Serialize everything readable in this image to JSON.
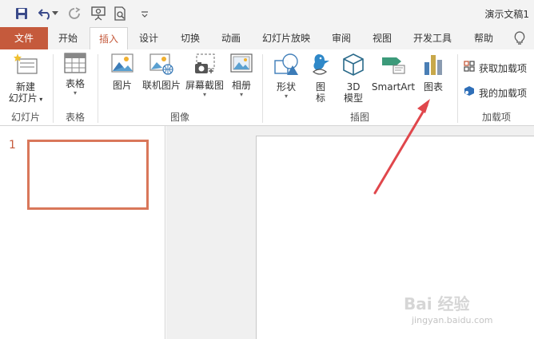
{
  "window": {
    "title": "演示文稿1"
  },
  "quick_access": [
    {
      "name": "save-icon"
    },
    {
      "name": "undo-icon"
    },
    {
      "name": "undo-dropdown-icon"
    },
    {
      "name": "redo-icon"
    },
    {
      "name": "present-from-start-icon"
    },
    {
      "name": "print-preview-icon"
    },
    {
      "name": "customize-toolbar-icon"
    }
  ],
  "tabs": [
    "文件",
    "开始",
    "插入",
    "设计",
    "切换",
    "动画",
    "幻灯片放映",
    "审阅",
    "视图",
    "开发工具",
    "帮助"
  ],
  "active_tab": "插入",
  "tell_me_icon": "lightbulb-icon",
  "ribbon": {
    "slides": {
      "label": "幻灯片",
      "new_slide_line1": "新建",
      "new_slide_line2": "幻灯片"
    },
    "tables": {
      "label": "表格",
      "table": "表格"
    },
    "images": {
      "label": "图像",
      "picture": "图片",
      "online_picture": "联机图片",
      "screenshot": "屏幕截图",
      "album": "相册"
    },
    "illustrations": {
      "label": "插图",
      "shapes": "形状",
      "icons_line1": "图",
      "icons_line2": "标",
      "model3d_line1": "3D",
      "model3d_line2": "模型",
      "smartart": "SmartArt",
      "chart": "图表"
    },
    "addins": {
      "label": "加载项",
      "get_addins": "获取加载项",
      "my_addins": "我的加载项"
    }
  },
  "slides_pane": {
    "slide_number": "1"
  },
  "watermark": {
    "text": "Bai 经验",
    "sub": "jingyan.baidu.com"
  },
  "colors": {
    "accent": "#c55a3c",
    "arrow": "#e0474c"
  }
}
